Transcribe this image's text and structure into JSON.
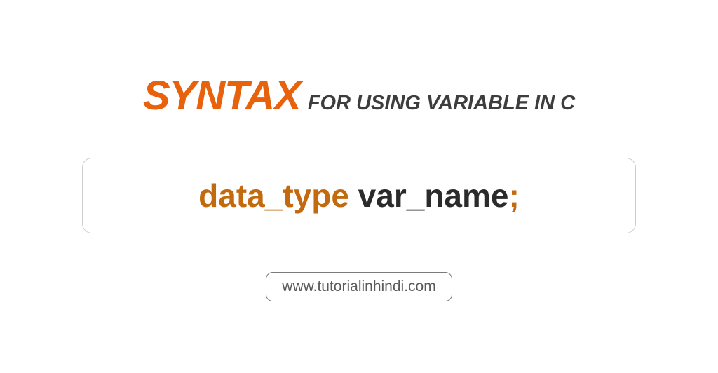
{
  "title": {
    "highlight": "SYNTAX",
    "rest": "FOR USING VARIABLE IN C"
  },
  "code": {
    "data_type": "data_type",
    "var_name": " var_name",
    "semicolon": ";"
  },
  "url": "www.tutorialinhindi.com"
}
